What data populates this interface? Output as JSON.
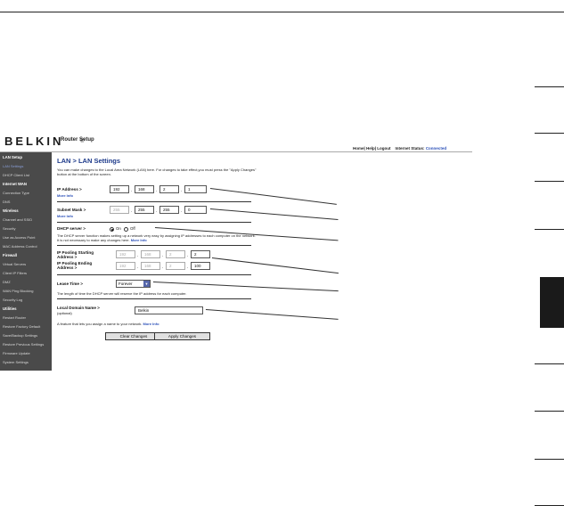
{
  "router": {
    "brand": "BELKIN",
    "brand_mark": "®",
    "title": "Router Setup",
    "header_links": "Home| Help| Logout",
    "status_label": "Internet Status:",
    "status_value": "Connected"
  },
  "sidebar": {
    "items": [
      {
        "label": "LAN Setup",
        "type": "head"
      },
      {
        "label": "LAN Settings",
        "type": "active"
      },
      {
        "label": "DHCP Client List",
        "type": "item"
      },
      {
        "label": "Internet WAN",
        "type": "head"
      },
      {
        "label": "Connection Type",
        "type": "item"
      },
      {
        "label": "DNS",
        "type": "item"
      },
      {
        "label": "Wireless",
        "type": "head"
      },
      {
        "label": "Channel and SSID",
        "type": "item"
      },
      {
        "label": "Security",
        "type": "item"
      },
      {
        "label": "Use as Access Point",
        "type": "item"
      },
      {
        "label": "MAC Address Control",
        "type": "item"
      },
      {
        "label": "Firewall",
        "type": "head"
      },
      {
        "label": "Virtual Servers",
        "type": "item"
      },
      {
        "label": "Client IP Filters",
        "type": "item"
      },
      {
        "label": "DMZ",
        "type": "item"
      },
      {
        "label": "WAN Ping Blocking",
        "type": "item"
      },
      {
        "label": "Security Log",
        "type": "item"
      },
      {
        "label": "Utilities",
        "type": "head"
      },
      {
        "label": "Restart Router",
        "type": "item"
      },
      {
        "label": "Restore Factory Default",
        "type": "item"
      },
      {
        "label": "Save/Backup Settings",
        "type": "item"
      },
      {
        "label": "Restore Previous Settings",
        "type": "item"
      },
      {
        "label": "Firmware Update",
        "type": "item"
      },
      {
        "label": "System Settings",
        "type": "item"
      }
    ]
  },
  "page": {
    "title": "LAN > LAN Settings",
    "intro": "You can make changes to the Local Area Network (LAN) here. For changes to take effect,you must press the \"Apply Changes\" button at the bottom of the screen.",
    "ip_label": "IP Address >",
    "ip": [
      "192",
      "168",
      "2",
      "1"
    ],
    "ip_more": "More Info",
    "subnet_label": "Subnet Mask >",
    "subnet": [
      "255",
      "255",
      "255",
      "0"
    ],
    "subnet_more": "More Info",
    "dhcp_label": "DHCP server >",
    "dhcp_on": "On",
    "dhcp_off": "Off",
    "dhcp_desc": "The DHCP server function makes setting up a network very easy by assigning IP addresses to each computer on the network. It is not necessary to make any changes here.",
    "dhcp_more": "More Info",
    "pool_start_label": "IP Pooling Starting Address >",
    "pool_start": [
      "192",
      "168",
      "2",
      "2"
    ],
    "pool_end_label": "IP Pooling Ending Address >",
    "pool_end": [
      "192",
      "168",
      "2",
      "100"
    ],
    "lease_label": "Lease Time >",
    "lease_value": "Forever",
    "lease_desc": "The length of time the DHCP server will reserve the IP address for each computer.",
    "domain_label": "Local Domain Name >",
    "domain_optional": "(optional)",
    "domain_value": "Belkin",
    "domain_desc": "A feature that lets you assign a name to your network.",
    "domain_more": "More Info",
    "clear_button": "Clear Changes",
    "apply_button": "Apply Changes"
  }
}
